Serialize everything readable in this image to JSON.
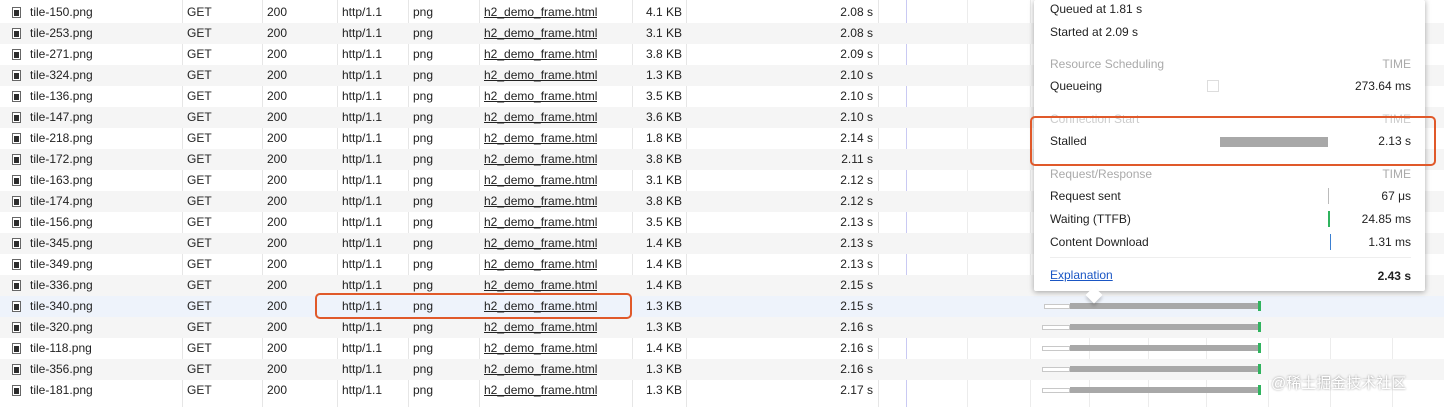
{
  "requests": [
    {
      "name": "tile-150.png",
      "method": "GET",
      "status": "200",
      "protocol": "http/1.1",
      "type": "png",
      "initiator": "h2_demo_frame.html",
      "size": "4.1 KB",
      "time": "2.08 s",
      "icon": "image-file-icon"
    },
    {
      "name": "tile-253.png",
      "method": "GET",
      "status": "200",
      "protocol": "http/1.1",
      "type": "png",
      "initiator": "h2_demo_frame.html",
      "size": "3.1 KB",
      "time": "2.08 s",
      "icon": "image-file-icon"
    },
    {
      "name": "tile-271.png",
      "method": "GET",
      "status": "200",
      "protocol": "http/1.1",
      "type": "png",
      "initiator": "h2_demo_frame.html",
      "size": "3.8 KB",
      "time": "2.09 s",
      "icon": "image-file-icon"
    },
    {
      "name": "tile-324.png",
      "method": "GET",
      "status": "200",
      "protocol": "http/1.1",
      "type": "png",
      "initiator": "h2_demo_frame.html",
      "size": "1.3 KB",
      "time": "2.10 s",
      "icon": "image-file-icon"
    },
    {
      "name": "tile-136.png",
      "method": "GET",
      "status": "200",
      "protocol": "http/1.1",
      "type": "png",
      "initiator": "h2_demo_frame.html",
      "size": "3.5 KB",
      "time": "2.10 s",
      "icon": "image-file-icon"
    },
    {
      "name": "tile-147.png",
      "method": "GET",
      "status": "200",
      "protocol": "http/1.1",
      "type": "png",
      "initiator": "h2_demo_frame.html",
      "size": "3.6 KB",
      "time": "2.10 s",
      "icon": "image-file-icon"
    },
    {
      "name": "tile-218.png",
      "method": "GET",
      "status": "200",
      "protocol": "http/1.1",
      "type": "png",
      "initiator": "h2_demo_frame.html",
      "size": "1.8 KB",
      "time": "2.14 s",
      "icon": "image-file-icon"
    },
    {
      "name": "tile-172.png",
      "method": "GET",
      "status": "200",
      "protocol": "http/1.1",
      "type": "png",
      "initiator": "h2_demo_frame.html",
      "size": "3.8 KB",
      "time": "2.11 s",
      "icon": "image-file-icon"
    },
    {
      "name": "tile-163.png",
      "method": "GET",
      "status": "200",
      "protocol": "http/1.1",
      "type": "png",
      "initiator": "h2_demo_frame.html",
      "size": "3.1 KB",
      "time": "2.12 s",
      "icon": "image-file-icon"
    },
    {
      "name": "tile-174.png",
      "method": "GET",
      "status": "200",
      "protocol": "http/1.1",
      "type": "png",
      "initiator": "h2_demo_frame.html",
      "size": "3.8 KB",
      "time": "2.12 s",
      "icon": "image-file-icon"
    },
    {
      "name": "tile-156.png",
      "method": "GET",
      "status": "200",
      "protocol": "http/1.1",
      "type": "png",
      "initiator": "h2_demo_frame.html",
      "size": "3.5 KB",
      "time": "2.13 s",
      "icon": "image-file-icon"
    },
    {
      "name": "tile-345.png",
      "method": "GET",
      "status": "200",
      "protocol": "http/1.1",
      "type": "png",
      "initiator": "h2_demo_frame.html",
      "size": "1.4 KB",
      "time": "2.13 s",
      "icon": "image-file-icon"
    },
    {
      "name": "tile-349.png",
      "method": "GET",
      "status": "200",
      "protocol": "http/1.1",
      "type": "png",
      "initiator": "h2_demo_frame.html",
      "size": "1.4 KB",
      "time": "2.13 s",
      "icon": "image-file-icon"
    },
    {
      "name": "tile-336.png",
      "method": "GET",
      "status": "200",
      "protocol": "http/1.1",
      "type": "png",
      "initiator": "h2_demo_frame.html",
      "size": "1.4 KB",
      "time": "2.15 s",
      "icon": "image-file-icon"
    },
    {
      "name": "tile-340.png",
      "method": "GET",
      "status": "200",
      "protocol": "http/1.1",
      "type": "png",
      "initiator": "h2_demo_frame.html",
      "size": "1.3 KB",
      "time": "2.15 s",
      "icon": "image-file-icon"
    },
    {
      "name": "tile-320.png",
      "method": "GET",
      "status": "200",
      "protocol": "http/1.1",
      "type": "png",
      "initiator": "h2_demo_frame.html",
      "size": "1.3 KB",
      "time": "2.16 s",
      "icon": "image-file-icon"
    },
    {
      "name": "tile-118.png",
      "method": "GET",
      "status": "200",
      "protocol": "http/1.1",
      "type": "png",
      "initiator": "h2_demo_frame.html",
      "size": "1.4 KB",
      "time": "2.16 s",
      "icon": "image-file-icon"
    },
    {
      "name": "tile-356.png",
      "method": "GET",
      "status": "200",
      "protocol": "http/1.1",
      "type": "png",
      "initiator": "h2_demo_frame.html",
      "size": "1.3 KB",
      "time": "2.16 s",
      "icon": "image-file-icon"
    },
    {
      "name": "tile-181.png",
      "method": "GET",
      "status": "200",
      "protocol": "http/1.1",
      "type": "png",
      "initiator": "h2_demo_frame.html",
      "size": "1.3 KB",
      "time": "2.17 s",
      "icon": "image-file-icon"
    }
  ],
  "selected_row": "tile-340.png",
  "timing": {
    "queued_at": "Queued at 1.81 s",
    "started_at": "Started at 2.09 s",
    "resource_scheduling": {
      "header": "Resource Scheduling",
      "time_label": "TIME",
      "queueing_label": "Queueing",
      "queueing_value": "273.64 ms"
    },
    "connection_start": {
      "header": "Connection Start",
      "time_label": "TIME",
      "stalled_label": "Stalled",
      "stalled_value": "2.13 s"
    },
    "request_response": {
      "header": "Request/Response",
      "time_label": "TIME",
      "request_sent_label": "Request sent",
      "request_sent_value": "67 μs",
      "waiting_label": "Waiting (TTFB)",
      "waiting_value": "24.85 ms",
      "download_label": "Content Download",
      "download_value": "1.31 ms"
    },
    "explanation_link": "Explanation",
    "total": "2.43 s"
  },
  "watermark": "@稀土掘金技术社区",
  "colors": {
    "highlight_border": "#e0592a",
    "stalled_bar": "#a8a8a8",
    "waiting_bar": "#30b35e",
    "download_bar": "#3b7fd1",
    "link": "#1a56c4"
  }
}
